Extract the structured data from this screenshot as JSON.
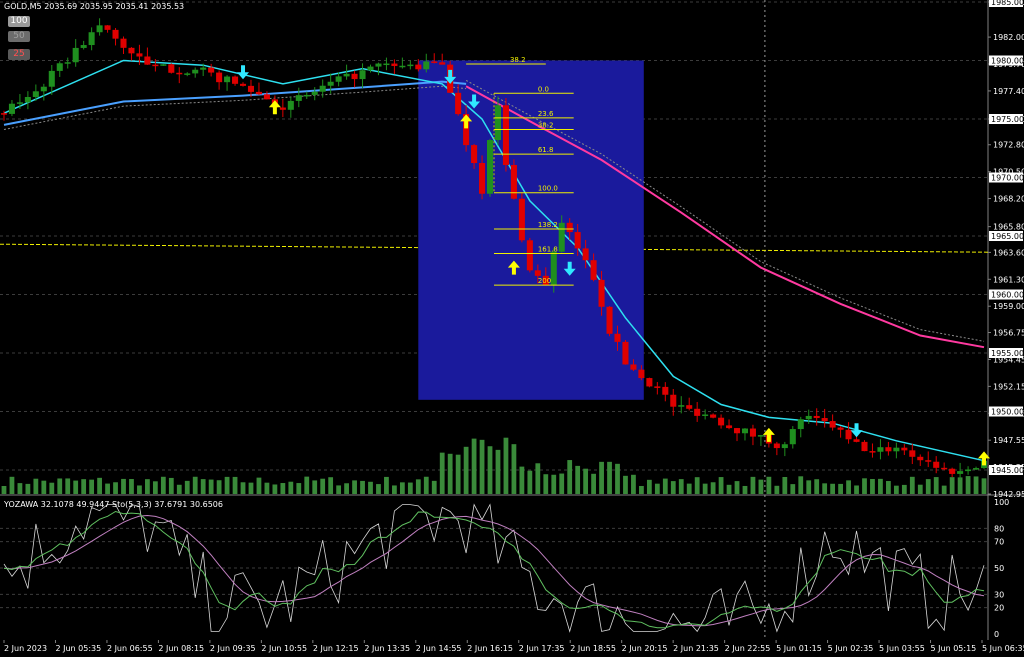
{
  "header": {
    "main_label": "GOLD,M5  2035.69 2035.95 2035.41 2035.53",
    "sub_label": "YOZAWA 32.1078 49.9447  Sto(5,3,3) 37.6791 30.6506"
  },
  "buttons": [
    {
      "label": "100",
      "bg": "#9a9a9a",
      "color": "#ffffff"
    },
    {
      "label": "50",
      "bg": "#6c6c6c",
      "color": "#a0a0a0"
    },
    {
      "label": "25",
      "bg": "#5a5a5a",
      "color": "#ff5050"
    }
  ],
  "colors": {
    "bull": "#1f8f1f",
    "bear": "#e00000",
    "ema_fast": "#2ee0f0",
    "ema_slow": "#4aa0ff",
    "ma_long": "#ff3aa0",
    "fib": "#f0f000",
    "box": "#1a1a9c",
    "volume": "#3a8a3a",
    "grid": "#3c3c3c",
    "arrow_up": "#ffff00",
    "arrow_down": "#30e8ff",
    "osc_white": "#d8d8d8",
    "osc_green": "#60c060",
    "osc_violet": "#c080c0",
    "axis_text": "#ffffff"
  },
  "chart_data": [
    {
      "type": "candlestick",
      "title": "GOLD,M5",
      "ylim": [
        1942.95,
        1985.0
      ],
      "y_ticks": [
        "1985.00",
        "1982.00",
        "1979.70",
        "1977.40",
        "1975.00",
        "1972.80",
        "1970.50",
        "1968.20",
        "1965.80",
        "1963.60",
        "1961.30",
        "1959.00",
        "1956.75",
        "1954.45",
        "1952.15",
        "1949.85",
        "1947.55",
        "1945.25",
        "1942.95"
      ],
      "price_labels": [
        "1985.00",
        "1980.00",
        "1975.00",
        "1970.00",
        "1965.00",
        "1960.00",
        "1955.00",
        "1950.00",
        "1945.00"
      ],
      "x_labels": [
        "2 Jun 2023",
        "2 Jun 05:35",
        "2 Jun 06:55",
        "2 Jun 08:15",
        "2 Jun 09:35",
        "2 Jun 10:55",
        "2 Jun 12:15",
        "2 Jun 13:35",
        "2 Jun 14:55",
        "2 Jun 16:15",
        "2 Jun 17:35",
        "2 Jun 18:55",
        "2 Jun 20:15",
        "2 Jun 21:35",
        "2 Jun 22:55",
        "5 Jun 01:15",
        "5 Jun 02:35",
        "5 Jun 03:55",
        "5 Jun 05:15",
        "5 Jun 06:35"
      ],
      "price_path": [
        [
          0,
          1975.5
        ],
        [
          5,
          1978
        ],
        [
          12,
          1983
        ],
        [
          18,
          1979.5
        ],
        [
          25,
          1979
        ],
        [
          31,
          1977.5
        ],
        [
          35,
          1976
        ],
        [
          41,
          1978
        ],
        [
          47,
          1979.5
        ],
        [
          52,
          1979.5
        ],
        [
          55,
          1979.8
        ],
        [
          58,
          1973
        ],
        [
          59,
          1971.5
        ],
        [
          60,
          1969
        ],
        [
          61,
          1973
        ],
        [
          62,
          1976
        ],
        [
          63,
          1971
        ],
        [
          64,
          1968
        ],
        [
          66,
          1962
        ],
        [
          68,
          1961
        ],
        [
          70,
          1966
        ],
        [
          72,
          1964
        ],
        [
          74,
          1961.5
        ],
        [
          76,
          1957
        ],
        [
          78,
          1954.2
        ],
        [
          80,
          1953
        ],
        [
          82,
          1952
        ],
        [
          84,
          1950.5
        ],
        [
          88,
          1949.8
        ],
        [
          92,
          1948.5
        ],
        [
          96,
          1947.5
        ],
        [
          98,
          1947
        ],
        [
          100,
          1949.5
        ],
        [
          104,
          1948.8
        ],
        [
          106,
          1947.5
        ],
        [
          109,
          1946.5
        ],
        [
          112,
          1947
        ],
        [
          115,
          1946
        ],
        [
          118,
          1945
        ],
        [
          120,
          1944.8
        ],
        [
          123,
          1945.8
        ]
      ],
      "ema_fast": [
        [
          0,
          1975.5
        ],
        [
          15,
          1980
        ],
        [
          25,
          1979.6
        ],
        [
          35,
          1978
        ],
        [
          45,
          1979.3
        ],
        [
          55,
          1978
        ],
        [
          60,
          1975
        ],
        [
          66,
          1968
        ],
        [
          72,
          1964
        ],
        [
          78,
          1958
        ],
        [
          84,
          1953
        ],
        [
          90,
          1950.6
        ],
        [
          96,
          1949.5
        ],
        [
          104,
          1949
        ],
        [
          112,
          1947.5
        ],
        [
          123,
          1945.8
        ]
      ],
      "ema_slow": [
        [
          0,
          1974.5
        ],
        [
          15,
          1976.5
        ],
        [
          30,
          1977
        ],
        [
          45,
          1977.7
        ],
        [
          55,
          1978.2
        ],
        [
          58,
          1978
        ]
      ],
      "ma_long": [
        [
          58,
          1977.8
        ],
        [
          66,
          1974.8
        ],
        [
          75,
          1971.5
        ],
        [
          85,
          1967
        ],
        [
          95,
          1962.3
        ],
        [
          105,
          1959.2
        ],
        [
          115,
          1956.5
        ],
        [
          123,
          1955.5
        ]
      ],
      "fib_levels": [
        {
          "label": "38.2",
          "price": 1979.7
        },
        {
          "label": "0.0",
          "price": 1977.2
        },
        {
          "label": "23.6",
          "price": 1975.1
        },
        {
          "label": "38.2",
          "price": 1974.1
        },
        {
          "label": "61.8",
          "price": 1972.0
        },
        {
          "label": "100.0",
          "price": 1968.7
        },
        {
          "label": "138.2",
          "price": 1965.6
        },
        {
          "label": "161.8",
          "price": 1963.5
        },
        {
          "label": "200",
          "price": 1960.8
        }
      ],
      "hline": 1964.3,
      "signals": [
        {
          "dir": "down",
          "bar": 30,
          "price": 1979.0
        },
        {
          "dir": "up",
          "bar": 34,
          "price": 1976.0
        },
        {
          "dir": "down",
          "bar": 56,
          "price": 1978.6
        },
        {
          "dir": "up",
          "bar": 58,
          "price": 1974.8
        },
        {
          "dir": "down",
          "bar": 59,
          "price": 1976.5
        },
        {
          "dir": "up",
          "bar": 64,
          "price": 1962.3
        },
        {
          "dir": "down",
          "bar": 71,
          "price": 1962.2
        },
        {
          "dir": "up",
          "bar": 96,
          "price": 1948.0
        },
        {
          "dir": "down",
          "bar": 107,
          "price": 1948.4
        },
        {
          "dir": "up",
          "bar": 123,
          "price": 1946.0
        }
      ]
    },
    {
      "type": "line",
      "title": "YOZAWA 32.1078 49.9447  Sto(5,3,3) 37.6791 30.6506",
      "ylim": [
        0,
        100
      ],
      "y_ticks": [
        "100",
        "80",
        "70",
        "50",
        "30",
        "20",
        "0"
      ],
      "series": [
        {
          "name": "YOZAWA",
          "values": [
            32.1078,
            49.9447
          ]
        },
        {
          "name": "Sto(5,3,3)",
          "values": [
            37.6791,
            30.6506
          ]
        }
      ]
    }
  ]
}
